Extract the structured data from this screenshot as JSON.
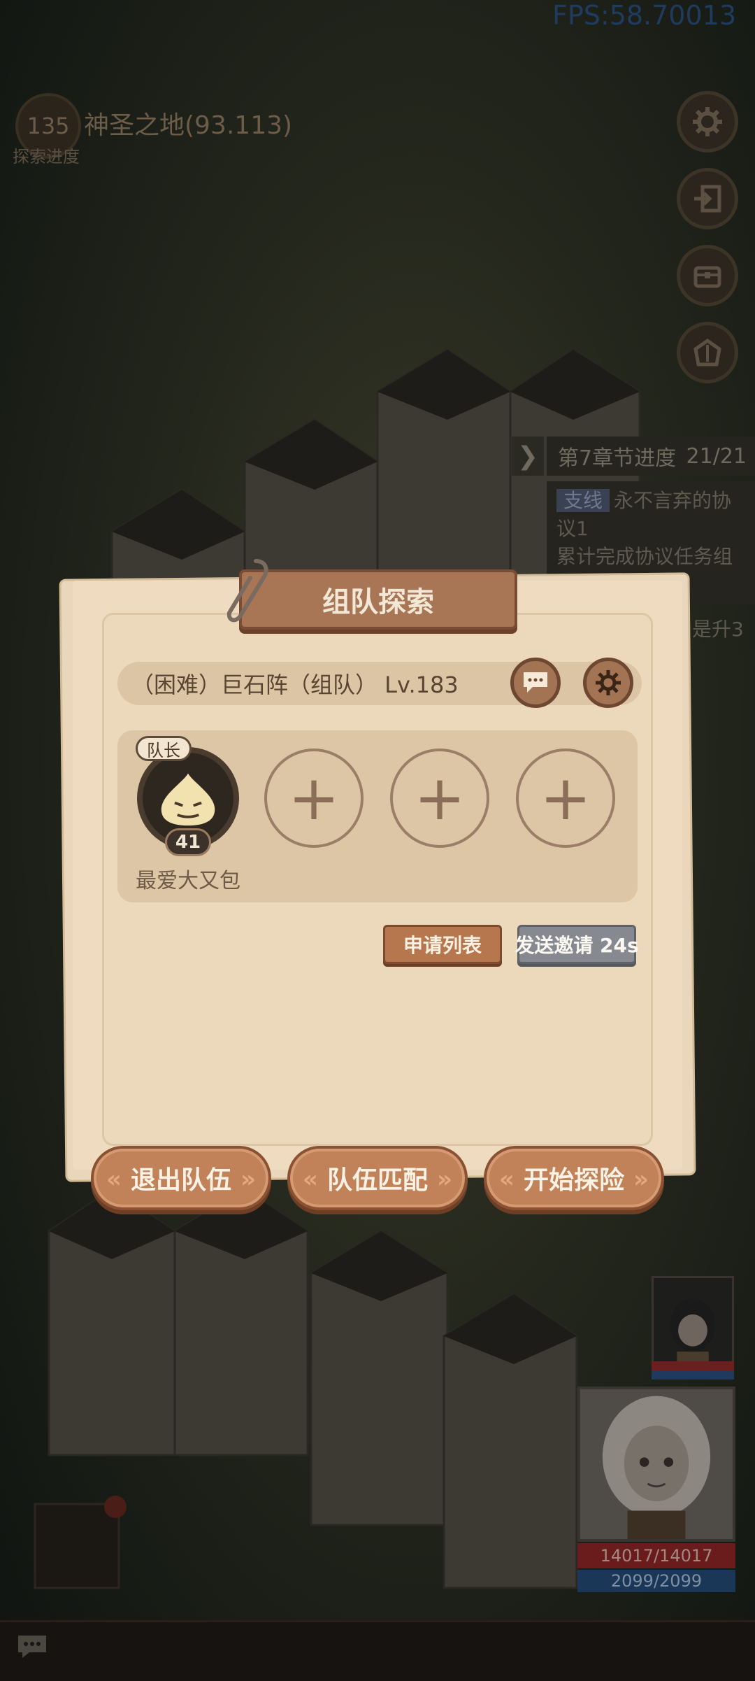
{
  "hud": {
    "fps": "FPS:58.70013",
    "exploration": {
      "progress_value": "135",
      "area_name": "神圣之地(93.113)",
      "label": "探索进度"
    },
    "right_buttons": [
      "gear-icon",
      "exit-icon",
      "chest-icon",
      "helmet-icon"
    ]
  },
  "chapter_panel": {
    "title": "第7章节进度",
    "progress": "21/21",
    "tag": "支线",
    "quest_name": "永不言弃的协议1",
    "quest_desc": "累计完成协议任务组",
    "extra_partial": "是升3"
  },
  "party_dialog": {
    "title": "组队探索",
    "dungeon": "（困难）巨石阵（组队） Lv.183",
    "leader": {
      "tag": "队长",
      "level": "41",
      "name": "最爱大又包"
    },
    "empty_slot_symbol": "+",
    "buttons": {
      "apply_list": "申请列表",
      "send_invite": "发送邀请 24s",
      "leave": "退出队伍",
      "match": "队伍匹配",
      "start": "开始探险"
    }
  },
  "hero_status": {
    "hp": "14017/14017",
    "mp": "2099/2099"
  },
  "colors": {
    "paper": "#efdcc0",
    "button_brown": "#c18259",
    "invite_gray": "#868a90",
    "hp_red": "#6a1c1c",
    "mp_blue": "#1b3758"
  }
}
